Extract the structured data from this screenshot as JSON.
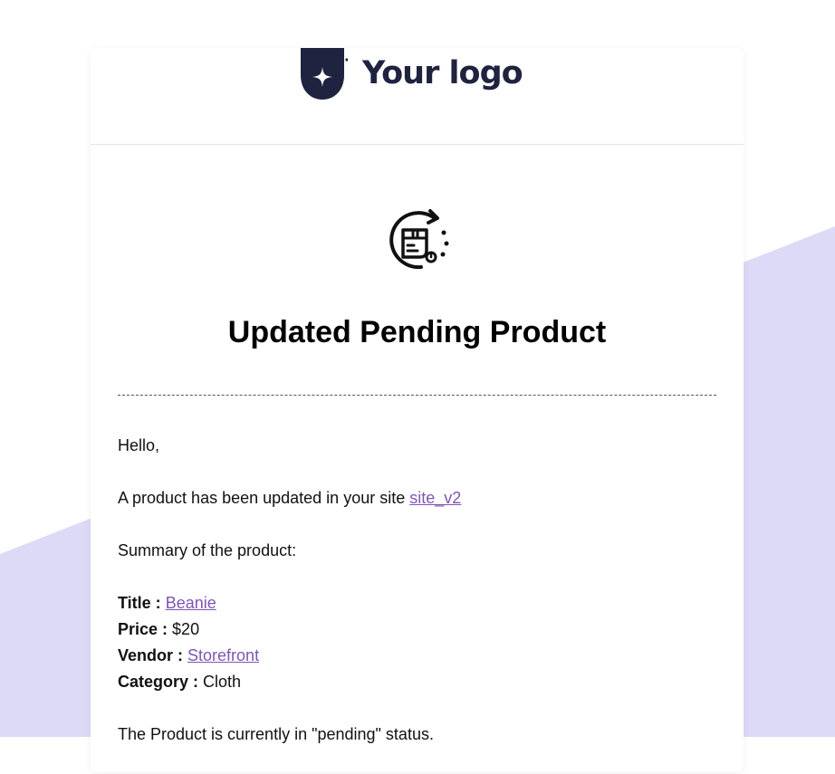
{
  "colors": {
    "page_background": "#ffffff",
    "decorative_shape": "#dcdaf7",
    "card_background": "#ffffff",
    "logo_text": "#1f2340",
    "link": "#7f54b3",
    "text": "#111111"
  },
  "header": {
    "logo_text": "Your logo",
    "logo_icon": "shield-star-icon"
  },
  "hero": {
    "icon": "package-refresh-icon",
    "title": "Updated Pending Product"
  },
  "body": {
    "greeting": "Hello,",
    "intro_text": "A product has been updated in your site ",
    "site_link": "site_v2",
    "summary_heading": "Summary of the product:",
    "fields": {
      "title_label": "Title :",
      "title_value": "Beanie",
      "price_label": "Price :",
      "price_value": "$20",
      "vendor_label": "Vendor :",
      "vendor_value": "Storefront",
      "category_label": "Category :",
      "category_value": "Cloth"
    },
    "status_text": "The Product is currently in \"pending\" status."
  }
}
